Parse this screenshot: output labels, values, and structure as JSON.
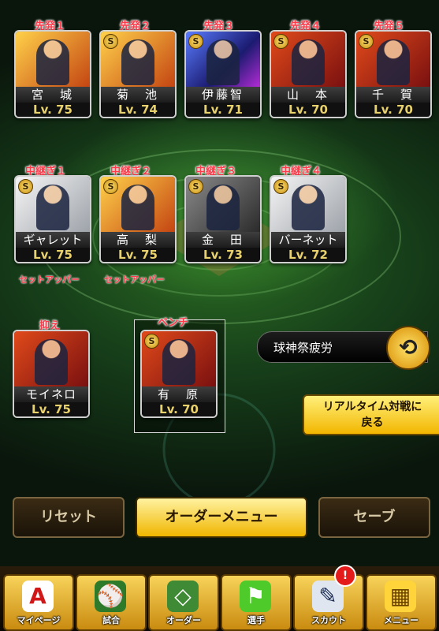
{
  "starters": [
    {
      "slot": "先発１",
      "name": "宮　城",
      "level": "Lv. 75",
      "art": "gold"
    },
    {
      "slot": "先発２",
      "name": "菊　池",
      "level": "Lv. 74",
      "art": "gold"
    },
    {
      "slot": "先発３",
      "name": "伊藤智",
      "level": "Lv. 71",
      "art": "blue"
    },
    {
      "slot": "先発４",
      "name": "山　本",
      "level": "Lv. 70",
      "art": "red"
    },
    {
      "slot": "先発５",
      "name": "千　賀",
      "level": "Lv. 70",
      "art": "red"
    }
  ],
  "relievers": [
    {
      "slot": "中継ぎ１",
      "name": "ギャレット",
      "level": "Lv. 75",
      "role": "セットアッパー",
      "art": "white"
    },
    {
      "slot": "中継ぎ２",
      "name": "高　梨",
      "level": "Lv. 75",
      "role": "セットアッパー",
      "art": "gold"
    },
    {
      "slot": "中継ぎ３",
      "name": "金　田",
      "level": "Lv. 73",
      "role": "",
      "art": "gray"
    },
    {
      "slot": "中継ぎ４",
      "name": "バーネット",
      "level": "Lv. 72",
      "role": "",
      "art": "white"
    }
  ],
  "closer": {
    "slot": "抑え",
    "name": "モイネロ",
    "level": "Lv. 75",
    "art": "red"
  },
  "bench": {
    "slot": "ベンチ",
    "name": "有　原",
    "level": "Lv. 70",
    "art": "red"
  },
  "fatigue_button": {
    "label": "球神祭疲労",
    "icon": "rotate-icon"
  },
  "realtime_button": {
    "line1": "リアルタイム対戦に",
    "line2": "戻る"
  },
  "actions": {
    "reset": "リセット",
    "order_menu": "オーダーメニュー",
    "save": "セーブ"
  },
  "nav": [
    {
      "label": "マイページ",
      "icon": "mypage-icon",
      "glyph": "A"
    },
    {
      "label": "試合",
      "icon": "stadium-icon",
      "glyph": "⚾"
    },
    {
      "label": "オーダー",
      "icon": "lineup-icon",
      "glyph": "◇"
    },
    {
      "label": "選手",
      "icon": "player-icon",
      "glyph": "⚑"
    },
    {
      "label": "スカウト",
      "icon": "scout-icon",
      "glyph": "✎"
    },
    {
      "label": "メニュー",
      "icon": "menu-icon",
      "glyph": "▦"
    }
  ],
  "alert_badge": "!",
  "colors": {
    "accent_gold": "#f0b600",
    "slot_red": "#ff3b4b",
    "level_yellow": "#e9d26b"
  }
}
